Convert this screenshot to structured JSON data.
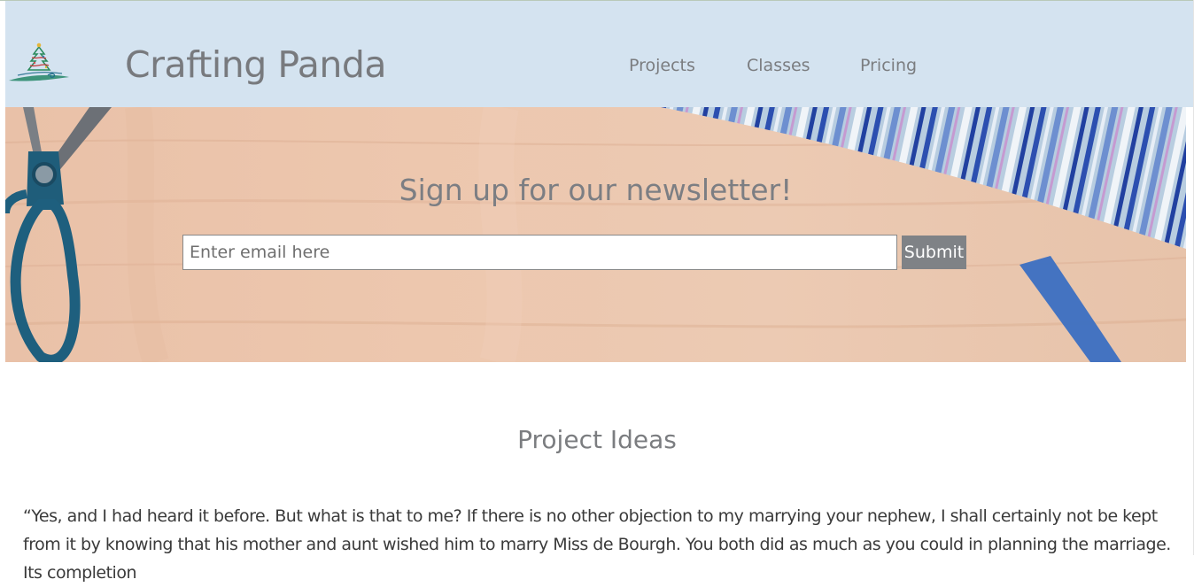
{
  "header": {
    "site_title": "Crafting Panda",
    "nav": [
      {
        "label": "Projects"
      },
      {
        "label": "Classes"
      },
      {
        "label": "Pricing"
      }
    ],
    "logo_icon": "christmas-tree-logo",
    "background": "#d4e3f0"
  },
  "hero": {
    "title": "Sign up for our newsletter!",
    "email_placeholder": "Enter email here",
    "submit_label": "Submit"
  },
  "section": {
    "title": "Project Ideas",
    "paragraph": "“Yes, and I had heard it before. But what is that to me? If there is no other objection to my marrying your nephew, I shall certainly not be kept from it by knowing that his mother and aunt wished him to marry Miss de Bourgh. You both did as much as you could in planning the marriage. Its completion"
  },
  "colors": {
    "title_gray": "#787a7e",
    "button_gray": "#7f8286"
  }
}
